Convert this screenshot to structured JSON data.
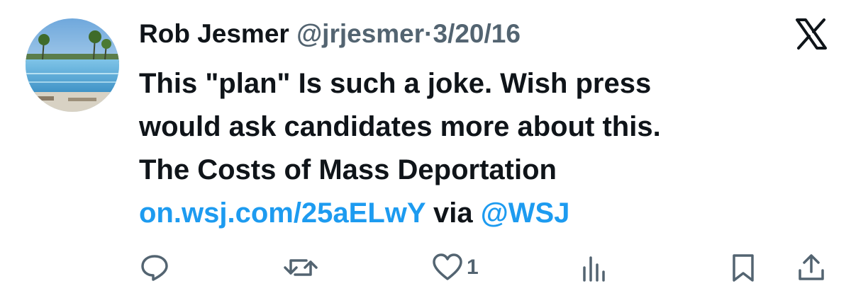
{
  "tweet": {
    "author_name": "Rob Jesmer",
    "handle": "@jrjesmer",
    "separator": "·",
    "date": "3/20/16",
    "text_lines": [
      "This \"plan\" Is such a joke.  Wish press",
      "would ask candidates more about this.",
      "The Costs of Mass Deportation"
    ],
    "link_text": "on.wsj.com/25aELwY",
    "via_text": "via",
    "mention": "@WSJ"
  },
  "actions": {
    "reply_icon": "reply-icon",
    "retweet_icon": "retweet-icon",
    "like_icon": "heart-icon",
    "like_count": "1",
    "views_icon": "views-icon",
    "bookmark_icon": "bookmark-icon",
    "share_icon": "share-icon"
  },
  "colors": {
    "text": "#0f1419",
    "muted": "#536471",
    "link": "#1d9bf0"
  }
}
